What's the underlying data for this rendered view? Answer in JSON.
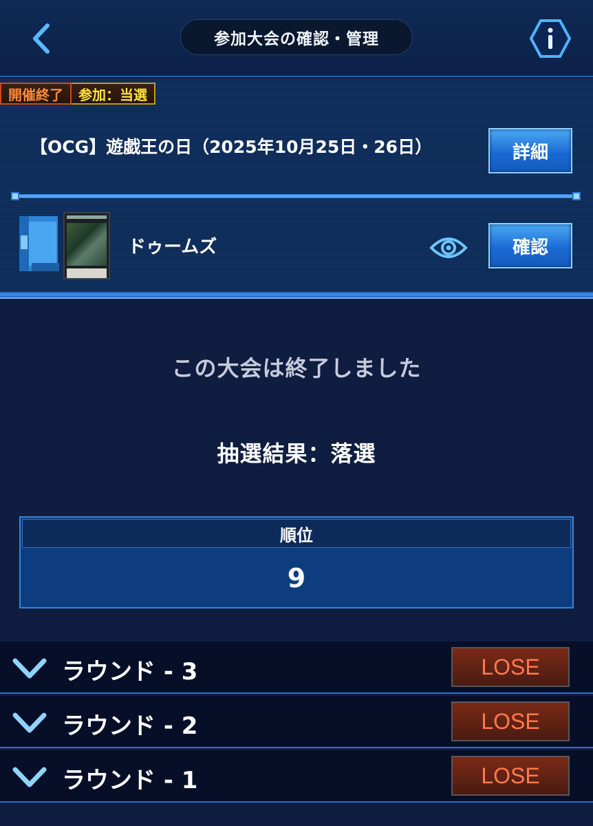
{
  "header": {
    "title": "参加大会の確認・管理",
    "back_icon": "chevron-left-icon",
    "info_icon": "info-hexagon-icon"
  },
  "tournament": {
    "status_badge": "開催終了",
    "participation_badge": "参加：当選",
    "name": "【OCG】遊戯王の日（2025年10月25日・26日）",
    "detail_button": "詳細"
  },
  "deck": {
    "name": "ドゥームズ",
    "view_icon": "eye-icon",
    "confirm_button": "確認"
  },
  "result": {
    "ended_message": "この大会は終了しました",
    "lottery_result": "抽選結果：落選",
    "rank_label": "順位",
    "rank_value": "9"
  },
  "rounds": [
    {
      "label": "ラウンド - 3",
      "result": "LOSE"
    },
    {
      "label": "ラウンド - 2",
      "result": "LOSE"
    },
    {
      "label": "ラウンド - 1",
      "result": "LOSE"
    }
  ],
  "colors": {
    "background": "#0e1d40",
    "accent_blue": "#1b6bd4",
    "lose_text": "#ff7a4e",
    "ended_badge": "#ff8a3a",
    "participation_badge": "#ffe23a"
  }
}
